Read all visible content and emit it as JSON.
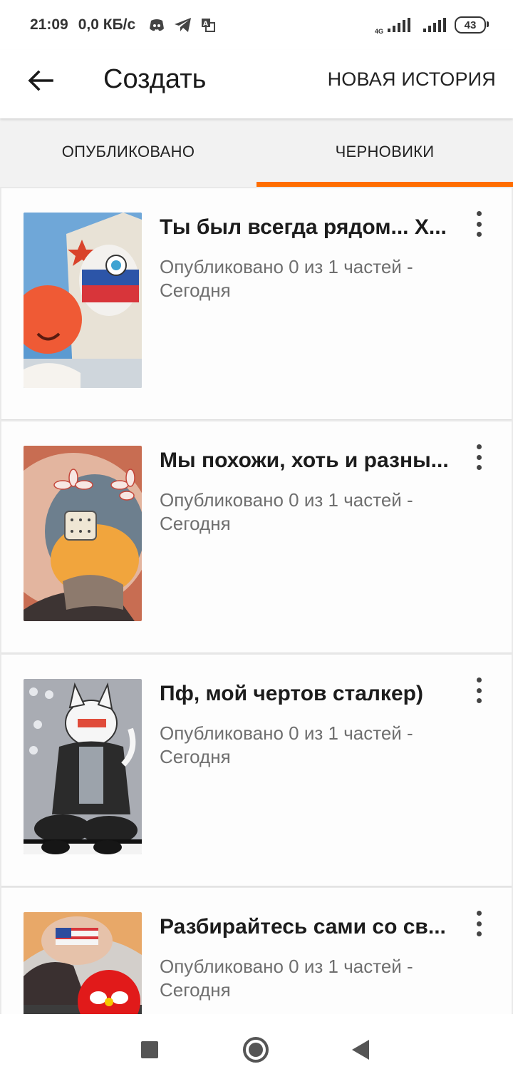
{
  "status_bar": {
    "time": "21:09",
    "speed": "0,0 КБ/с",
    "icons": [
      "discord-icon",
      "telegram-icon",
      "translate-icon"
    ],
    "network": "4G",
    "battery": "43"
  },
  "toolbar": {
    "title": "Создать",
    "new_story_label": "НОВАЯ ИСТОРИЯ",
    "back_icon": "arrow-left-icon"
  },
  "tabs": [
    {
      "label": "ОПУБЛИКОВАНО",
      "active": false
    },
    {
      "label": "ЧЕРНОВИКИ",
      "active": true
    }
  ],
  "accent_color": "#ff6d00",
  "stories": [
    {
      "title": "Ты был всегда рядом... Х...",
      "meta": "Опубликовано 0 из 1 частей - Сегодня"
    },
    {
      "title": "Мы похожи, хоть и разны...",
      "meta": "Опубликовано 0 из 1 частей - Сегодня"
    },
    {
      "title": "Пф, мой чертов сталкер)",
      "meta": "Опубликовано 0 из 1 частей - Сегодня"
    },
    {
      "title": "Разбирайтесь сами со св...",
      "meta": "Опубликовано 0 из 1 частей - Сегодня"
    }
  ],
  "nav_bar": {
    "icons": [
      "recent-apps-icon",
      "home-icon",
      "back-triangle-icon"
    ]
  }
}
